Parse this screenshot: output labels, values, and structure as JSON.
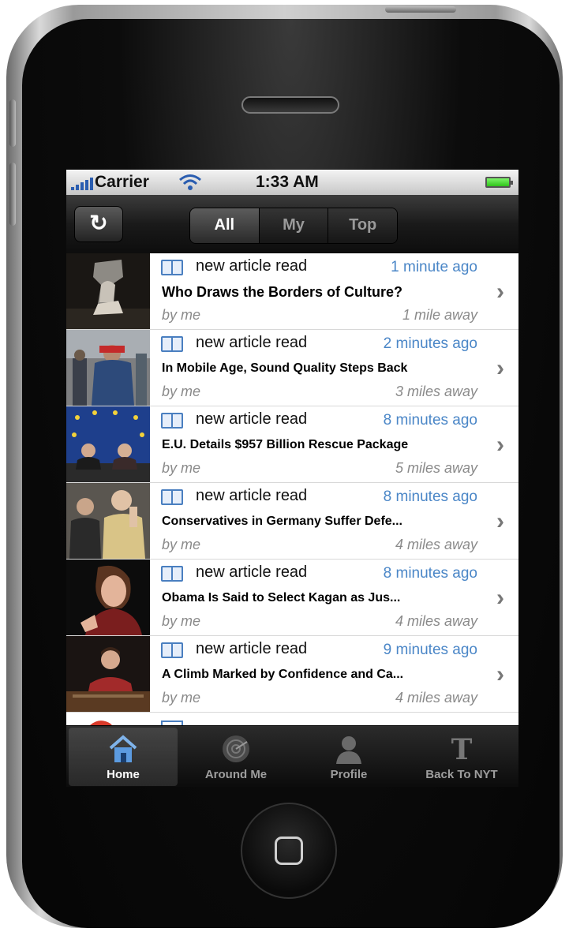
{
  "status_bar": {
    "carrier": "Carrier",
    "time": "1:33 AM"
  },
  "nav": {
    "refresh_icon": "refresh-icon",
    "segments": [
      {
        "label": "All",
        "active": true
      },
      {
        "label": "My",
        "active": false
      },
      {
        "label": "Top",
        "active": false
      }
    ]
  },
  "feed": {
    "items": [
      {
        "activity": "new article read",
        "time": "1 minute ago",
        "title": "Who Draws the Borders of Culture?",
        "byline": "by me",
        "distance": "1 mile away"
      },
      {
        "activity": "new article read",
        "time": "2 minutes ago",
        "title": "In Mobile Age, Sound Quality Steps Back",
        "byline": "by me",
        "distance": "3 miles away"
      },
      {
        "activity": "new article read",
        "time": "8 minutes ago",
        "title": "E.U. Details $957 Billion Rescue Package",
        "byline": "by me",
        "distance": "5 miles away"
      },
      {
        "activity": "new article read",
        "time": "8 minutes ago",
        "title": "Conservatives in Germany Suffer Defe...",
        "byline": "by me",
        "distance": "4 miles away"
      },
      {
        "activity": "new article read",
        "time": "8 minutes ago",
        "title": "Obama Is Said to Select Kagan as Jus...",
        "byline": "by me",
        "distance": "4 miles away"
      },
      {
        "activity": "new article read",
        "time": "9 minutes ago",
        "title": "A Climb Marked by Confidence and Ca...",
        "byline": "by me",
        "distance": "4 miles away"
      }
    ]
  },
  "tab_bar": {
    "tabs": [
      {
        "label": "Home",
        "icon": "home-icon",
        "active": true
      },
      {
        "label": "Around Me",
        "icon": "radar-icon",
        "active": false
      },
      {
        "label": "Profile",
        "icon": "profile-icon",
        "active": false
      },
      {
        "label": "Back To NYT",
        "icon": "nyt-logo-icon",
        "active": false
      }
    ]
  },
  "colors": {
    "accent_blue": "#4a86c7",
    "nav_dark": "#1a1a1a"
  }
}
